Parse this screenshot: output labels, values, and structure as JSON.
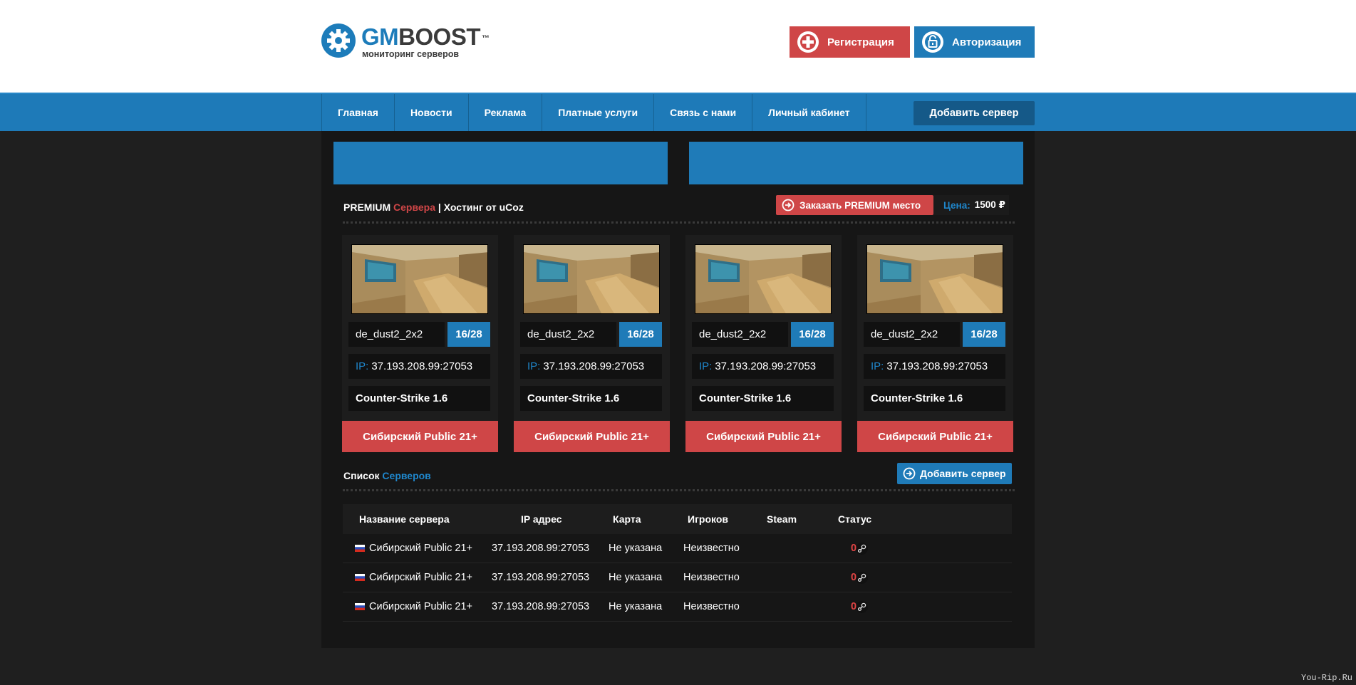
{
  "brand": {
    "name_part1": "GM",
    "name_part2": "BOOST",
    "tm": "™",
    "tagline": "мониторинг серверов"
  },
  "header_buttons": {
    "register": "Регистрация",
    "login": "Авторизация"
  },
  "nav": {
    "items": [
      {
        "label": "Главная"
      },
      {
        "label": "Новости"
      },
      {
        "label": "Реклама"
      },
      {
        "label": "Платные услуги"
      },
      {
        "label": "Связь с нами"
      },
      {
        "label": "Личный кабинет"
      }
    ],
    "add_server": "Добавить сервер"
  },
  "premium": {
    "title_a": "PREMIUM",
    "title_b": "Сервера",
    "title_sep": " | ",
    "title_c": "Хостинг от uCoz",
    "order_button": "Заказать PREMIUM место",
    "price_label": "Цена:",
    "price_value": "1500 ₽",
    "cards": [
      {
        "map": "de_dust2_2x2",
        "slots": "16/28",
        "ip_label": "IP:",
        "ip": "37.193.208.99:27053",
        "game": "Counter-Strike 1.6",
        "name": "Сибирский Public 21+"
      },
      {
        "map": "de_dust2_2x2",
        "slots": "16/28",
        "ip_label": "IP:",
        "ip": "37.193.208.99:27053",
        "game": "Counter-Strike 1.6",
        "name": "Сибирский Public 21+"
      },
      {
        "map": "de_dust2_2x2",
        "slots": "16/28",
        "ip_label": "IP:",
        "ip": "37.193.208.99:27053",
        "game": "Counter-Strike 1.6",
        "name": "Сибирский Public 21+"
      },
      {
        "map": "de_dust2_2x2",
        "slots": "16/28",
        "ip_label": "IP:",
        "ip": "37.193.208.99:27053",
        "game": "Counter-Strike 1.6",
        "name": "Сибирский Public 21+"
      }
    ]
  },
  "list": {
    "title_a": "Список",
    "title_b": "Серверов",
    "add_button": "Добавить сервер",
    "columns": {
      "name": "Название сервера",
      "ip": "IP адрес",
      "map": "Карта",
      "players": "Игроков",
      "steam": "Steam",
      "status": "Статус"
    },
    "rows": [
      {
        "name": "Сибирский Public 21+",
        "ip": "37.193.208.99:27053",
        "map": "Не указана",
        "players": "Неизвестно",
        "status": "0"
      },
      {
        "name": "Сибирский Public 21+",
        "ip": "37.193.208.99:27053",
        "map": "Не указана",
        "players": "Неизвестно",
        "status": "0"
      },
      {
        "name": "Сибирский Public 21+",
        "ip": "37.193.208.99:27053",
        "map": "Не указана",
        "players": "Неизвестно",
        "status": "0"
      }
    ]
  },
  "watermark": "You-Rip.Ru",
  "colors": {
    "accent_blue": "#1f7bb8",
    "accent_red": "#cf4647",
    "background": "#1f1f1f",
    "panel": "#161616"
  },
  "icons": {
    "logo": "gear-icon",
    "register": "plus-circle-icon",
    "login": "lock-icon",
    "order": "arrow-circle-icon",
    "add": "arrow-circle-icon",
    "flag": "russia-flag-icon",
    "steam": "steam-icon"
  }
}
